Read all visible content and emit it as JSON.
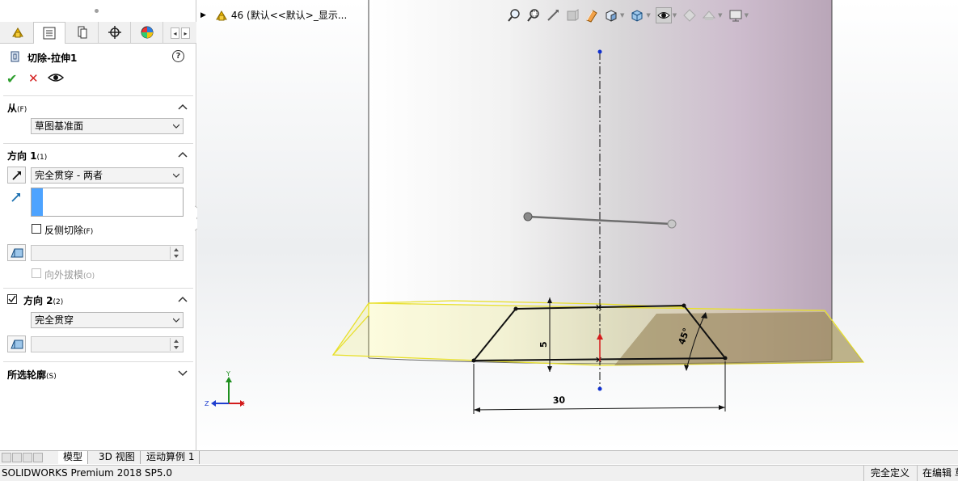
{
  "feature": {
    "title": "切除-拉伸1"
  },
  "panel_tabs": [
    "feature-manager",
    "property-manager",
    "configuration-manager",
    "dimxpert-manager",
    "display-manager"
  ],
  "sections": {
    "from": {
      "label": "从",
      "sub": "(F)",
      "value": "草图基准面"
    },
    "direction1": {
      "label": "方向 1",
      "sub": "(1)",
      "end_condition": "完全贯穿 - 两者",
      "flip_side": "反侧切除",
      "flip_side_sub": "(F)",
      "draft": "向外拔模",
      "draft_sub": "(O)"
    },
    "direction2": {
      "label": "方向 2",
      "sub": "(2)",
      "end_condition": "完全贯穿"
    },
    "contours": {
      "label": "所选轮廓",
      "sub": "(S)"
    }
  },
  "breadcrumb": {
    "text": "46 (默认<<默认>_显示..."
  },
  "sketch": {
    "dim_height": "5",
    "dim_width": "30",
    "dim_angle": "45°"
  },
  "triad": {
    "y": "Y",
    "z": "Z",
    "x": "X"
  },
  "bottom_tabs": [
    "模型",
    "3D 视图",
    "运动算例 1"
  ],
  "status": {
    "product": "SOLIDWORKS Premium 2018 SP5.0",
    "definition": "完全定义",
    "mode": "在编辑 草图"
  },
  "colors": {
    "accent_blue": "#4da3ff",
    "ok_green": "#2e9e2e",
    "cancel_red": "#d42020",
    "preview_yellow": "#f2ec4a",
    "body_tint": "#c8b4c8"
  }
}
